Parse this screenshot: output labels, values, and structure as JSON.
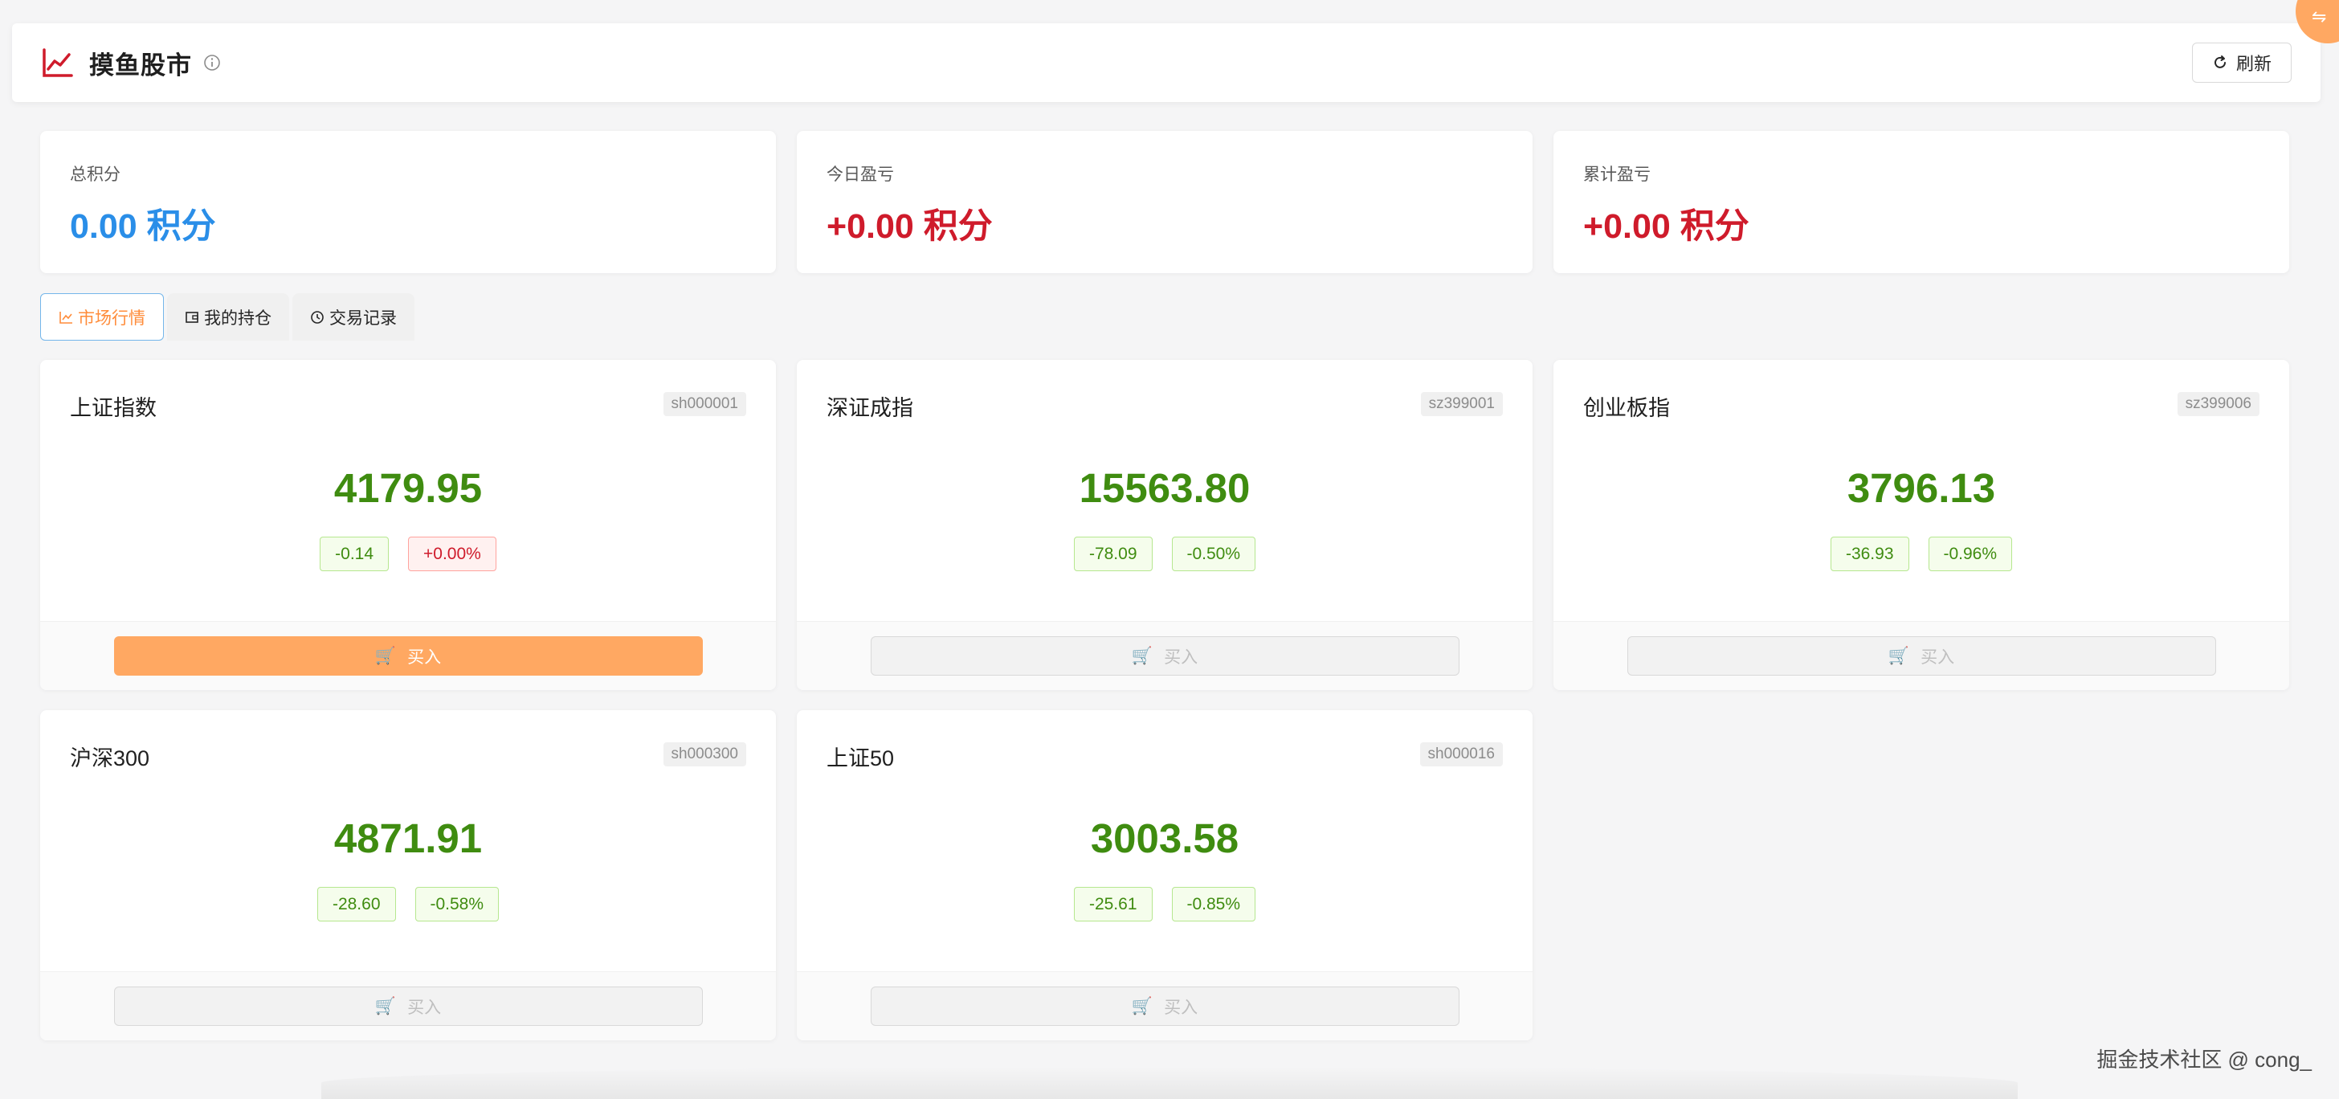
{
  "header": {
    "title": "摸鱼股市",
    "refresh_label": "刷新",
    "corner_icon": "⇋"
  },
  "summary": [
    {
      "label": "总积分",
      "value": "0.00 积分",
      "color": "#2a8ee8"
    },
    {
      "label": "今日盈亏",
      "value": "+0.00 积分",
      "color": "#cf1b2b"
    },
    {
      "label": "累计盈亏",
      "value": "+0.00 积分",
      "color": "#cf1b2b"
    }
  ],
  "tabs": [
    {
      "label": "市场行情",
      "icon": "chart-line-icon",
      "active": true
    },
    {
      "label": "我的持仓",
      "icon": "wallet-icon",
      "active": false
    },
    {
      "label": "交易记录",
      "icon": "history-icon",
      "active": false
    }
  ],
  "stocks": [
    {
      "name": "上证指数",
      "code": "sh000001",
      "price": "4179.95",
      "change": "-0.14",
      "change_pct": "+0.00%",
      "buy_label": "买入"
    },
    {
      "name": "深证成指",
      "code": "sz399001",
      "price": "15563.80",
      "change": "-78.09",
      "change_pct": "-0.50%",
      "buy_label": "买入"
    },
    {
      "name": "创业板指",
      "code": "sz399006",
      "price": "3796.13",
      "change": "-36.93",
      "change_pct": "-0.96%",
      "buy_label": "买入"
    },
    {
      "name": "沪深300",
      "code": "sh000300",
      "price": "4871.91",
      "change": "-28.60",
      "change_pct": "-0.58%",
      "buy_label": "买入"
    },
    {
      "name": "上证50",
      "code": "sh000016",
      "price": "3003.58",
      "change": "-25.61",
      "change_pct": "-0.85%",
      "buy_label": "买入"
    }
  ],
  "colors": {
    "accent": "#ffa862",
    "up": "#cf1b2b",
    "down": "#3f8c10",
    "primary": "#2a8ee8"
  },
  "watermark": "掘金技术社区 @ cong_"
}
